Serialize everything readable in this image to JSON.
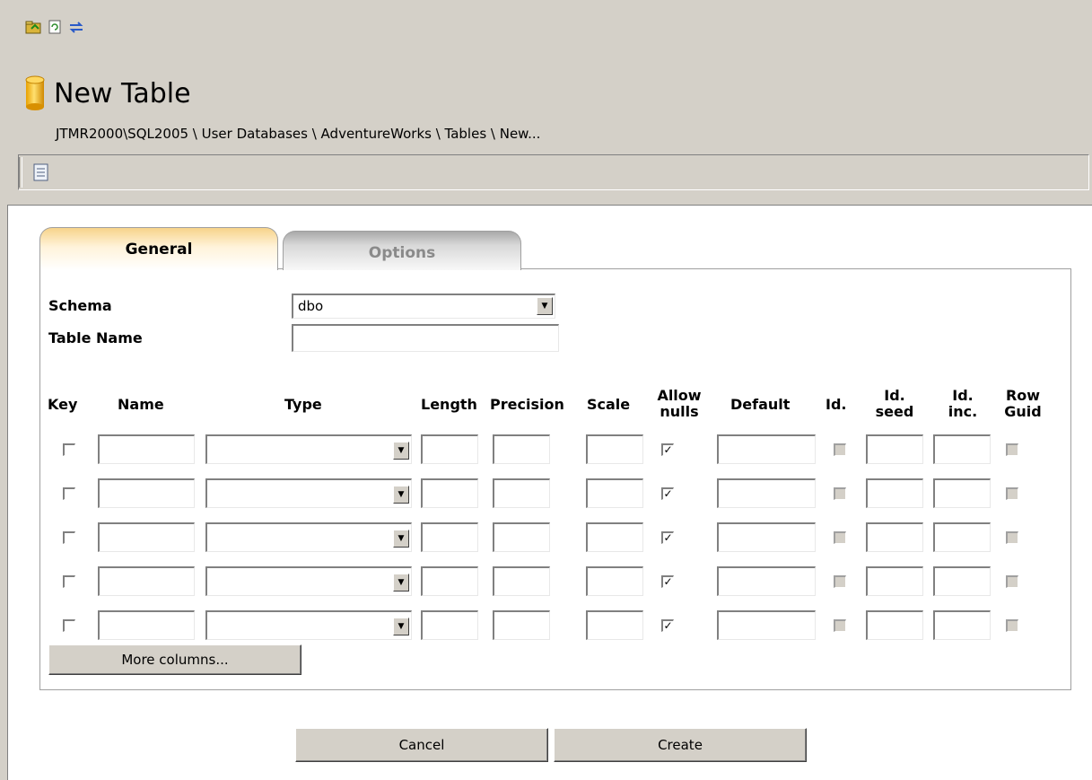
{
  "header": {
    "title": "New Table",
    "breadcrumb": "JTMR2000\\SQL2005 \\ User Databases \\ AdventureWorks \\ Tables \\ New..."
  },
  "toolbar": {
    "icons": [
      "open-folder-icon",
      "refresh-icon",
      "sync-icon"
    ]
  },
  "script_bar": {
    "icon": "script-icon"
  },
  "tabs": [
    {
      "label": "General",
      "active": true
    },
    {
      "label": "Options",
      "active": false
    }
  ],
  "form": {
    "schema_label": "Schema",
    "schema_value": "dbo",
    "table_name_label": "Table Name",
    "table_name_value": ""
  },
  "columns_table": {
    "headers": {
      "key": "Key",
      "name": "Name",
      "type": "Type",
      "length": "Length",
      "precision": "Precision",
      "scale": "Scale",
      "allow_nulls_1": "Allow",
      "allow_nulls_2": "nulls",
      "default": "Default",
      "identity": "Id.",
      "id_seed_1": "Id.",
      "id_seed_2": "seed",
      "id_inc_1": "Id.",
      "id_inc_2": "inc.",
      "row_guid_1": "Row",
      "row_guid_2": "Guid"
    },
    "rows": [
      {
        "key": false,
        "name": "",
        "type": "",
        "length": "",
        "precision": "",
        "scale": "",
        "allow_nulls": true,
        "default": "",
        "identity": false,
        "id_seed": "",
        "id_inc": "",
        "row_guid": false
      },
      {
        "key": false,
        "name": "",
        "type": "",
        "length": "",
        "precision": "",
        "scale": "",
        "allow_nulls": true,
        "default": "",
        "identity": false,
        "id_seed": "",
        "id_inc": "",
        "row_guid": false
      },
      {
        "key": false,
        "name": "",
        "type": "",
        "length": "",
        "precision": "",
        "scale": "",
        "allow_nulls": true,
        "default": "",
        "identity": false,
        "id_seed": "",
        "id_inc": "",
        "row_guid": false
      },
      {
        "key": false,
        "name": "",
        "type": "",
        "length": "",
        "precision": "",
        "scale": "",
        "allow_nulls": true,
        "default": "",
        "identity": false,
        "id_seed": "",
        "id_inc": "",
        "row_guid": false
      },
      {
        "key": false,
        "name": "",
        "type": "",
        "length": "",
        "precision": "",
        "scale": "",
        "allow_nulls": true,
        "default": "",
        "identity": false,
        "id_seed": "",
        "id_inc": "",
        "row_guid": false
      }
    ],
    "more_columns_label": "More columns..."
  },
  "actions": {
    "cancel_label": "Cancel",
    "create_label": "Create"
  }
}
